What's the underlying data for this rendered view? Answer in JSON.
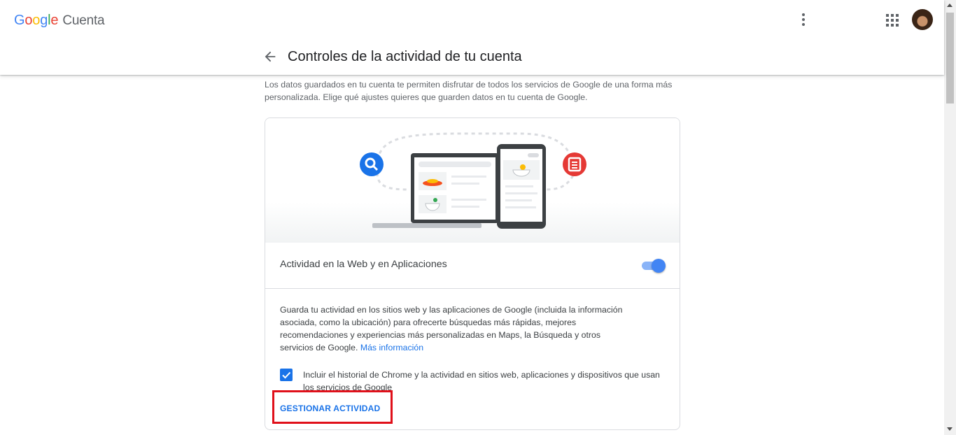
{
  "header": {
    "logo": {
      "letters": [
        "G",
        "o",
        "o",
        "g",
        "l",
        "e"
      ],
      "colors": [
        "#4285F4",
        "#EA4335",
        "#FBBC05",
        "#4285F4",
        "#34A853",
        "#EA4335"
      ],
      "product": "Cuenta"
    },
    "icons": [
      "more-vert-icon",
      "apps-grid-icon",
      "avatar"
    ]
  },
  "page": {
    "title": "Controles de la actividad de tu cuenta",
    "intro": "Los datos guardados en tu cuenta te permiten disfrutar de todos los servicios de Google de una forma más personalizada. Elige qué ajustes quieres que guarden datos en tu cuenta de Google."
  },
  "card": {
    "setting_title": "Actividad en la Web y en Aplicaciones",
    "toggle_on": true,
    "description": "Guarda tu actividad en los sitios web y las aplicaciones de Google (incluida la información asociada, como la ubicación) para ofrecerte búsquedas más rápidas, mejores recomendaciones y experiencias más personalizadas en Maps, la Búsqueda y otros servicios de Google.",
    "more_info_link": "Más información",
    "checkbox_checked": true,
    "checkbox_label": "Incluir el historial de Chrome y la actividad en sitios web, aplicaciones y dispositivos que usan los servicios de Google",
    "manage_button": "GESTIONAR ACTIVIDAD"
  },
  "colors": {
    "accent": "#1a73e8",
    "highlight": "#e0101a",
    "toggle_knob": "#4285f4"
  }
}
